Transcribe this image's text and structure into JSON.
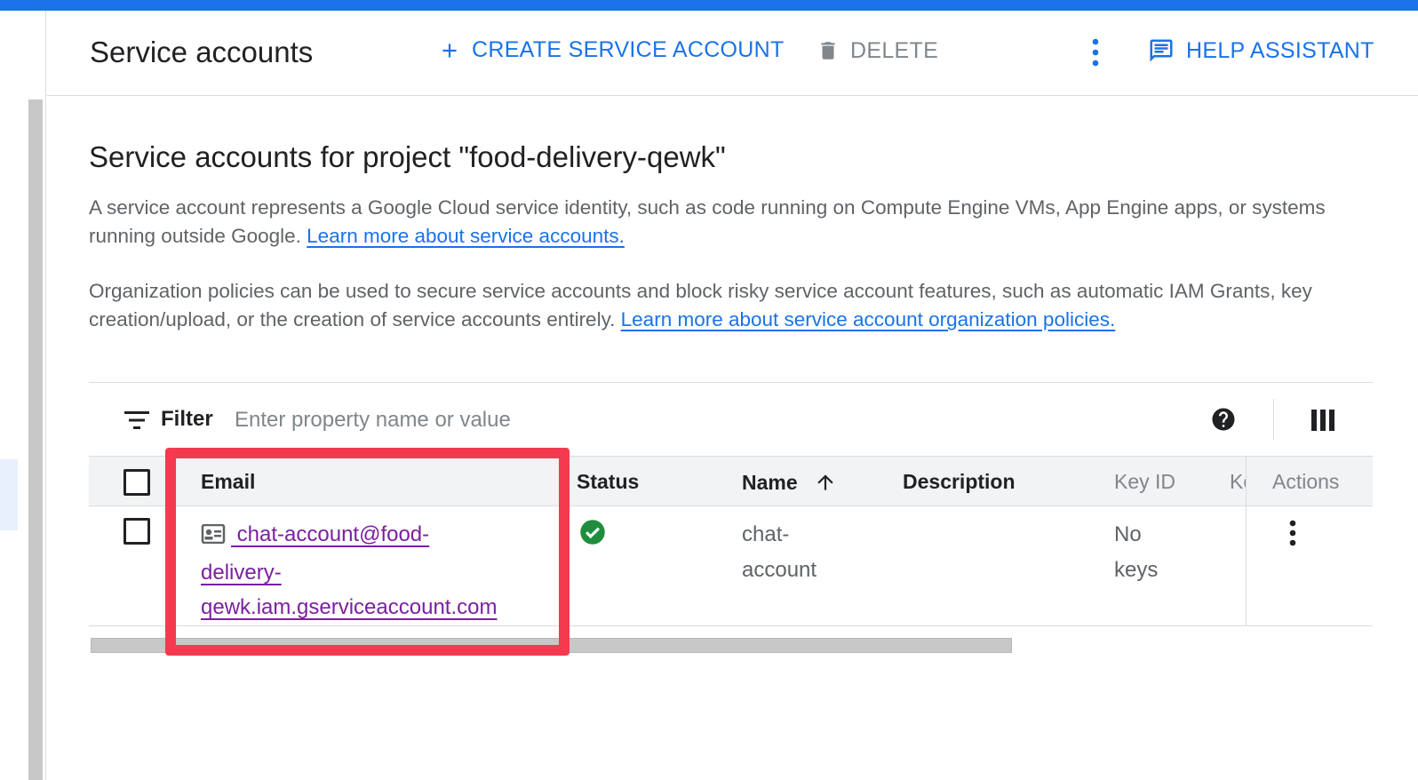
{
  "header": {
    "title": "Service accounts",
    "create_label": "CREATE SERVICE ACCOUNT",
    "delete_label": "DELETE",
    "help_label": "HELP ASSISTANT"
  },
  "main": {
    "section_title": "Service accounts for project \"food-delivery-qewk\"",
    "intro_text": "A service account represents a Google Cloud service identity, such as code running on Compute Engine VMs, App Engine apps, or systems running outside Google. ",
    "intro_link": "Learn more about service accounts.",
    "policy_text": "Organization policies can be used to secure service accounts and block risky service account features, such as automatic IAM Grants, key creation/upload, or the creation of service accounts entirely. ",
    "policy_link": "Learn more about service account organization policies."
  },
  "filter": {
    "label": "Filter",
    "placeholder": "Enter property name or value"
  },
  "table": {
    "columns": {
      "email": "Email",
      "status": "Status",
      "name": "Name",
      "description": "Description",
      "key_id": "Key ID",
      "key_creation": "Ke",
      "actions": "Actions"
    },
    "rows": [
      {
        "email_line1": " chat-account@food-",
        "email_line2": "delivery-",
        "email_line3": "qewk.iam.gserviceaccount.com",
        "status": "enabled",
        "name_line1": "chat-",
        "name_line2": "account",
        "description": "",
        "key_line1": "No",
        "key_line2": "keys"
      }
    ]
  },
  "colors": {
    "accent": "#1a73e8",
    "link_visited": "#7b1fa2",
    "status_ok": "#1e8e3e",
    "highlight": "#f43a4f"
  },
  "icons": [
    "plus-icon",
    "trash-icon",
    "more-vert-icon",
    "feedback-icon",
    "filter-icon",
    "help-icon",
    "columns-icon",
    "arrow-up-icon",
    "service-account-icon",
    "check-circle-icon"
  ]
}
